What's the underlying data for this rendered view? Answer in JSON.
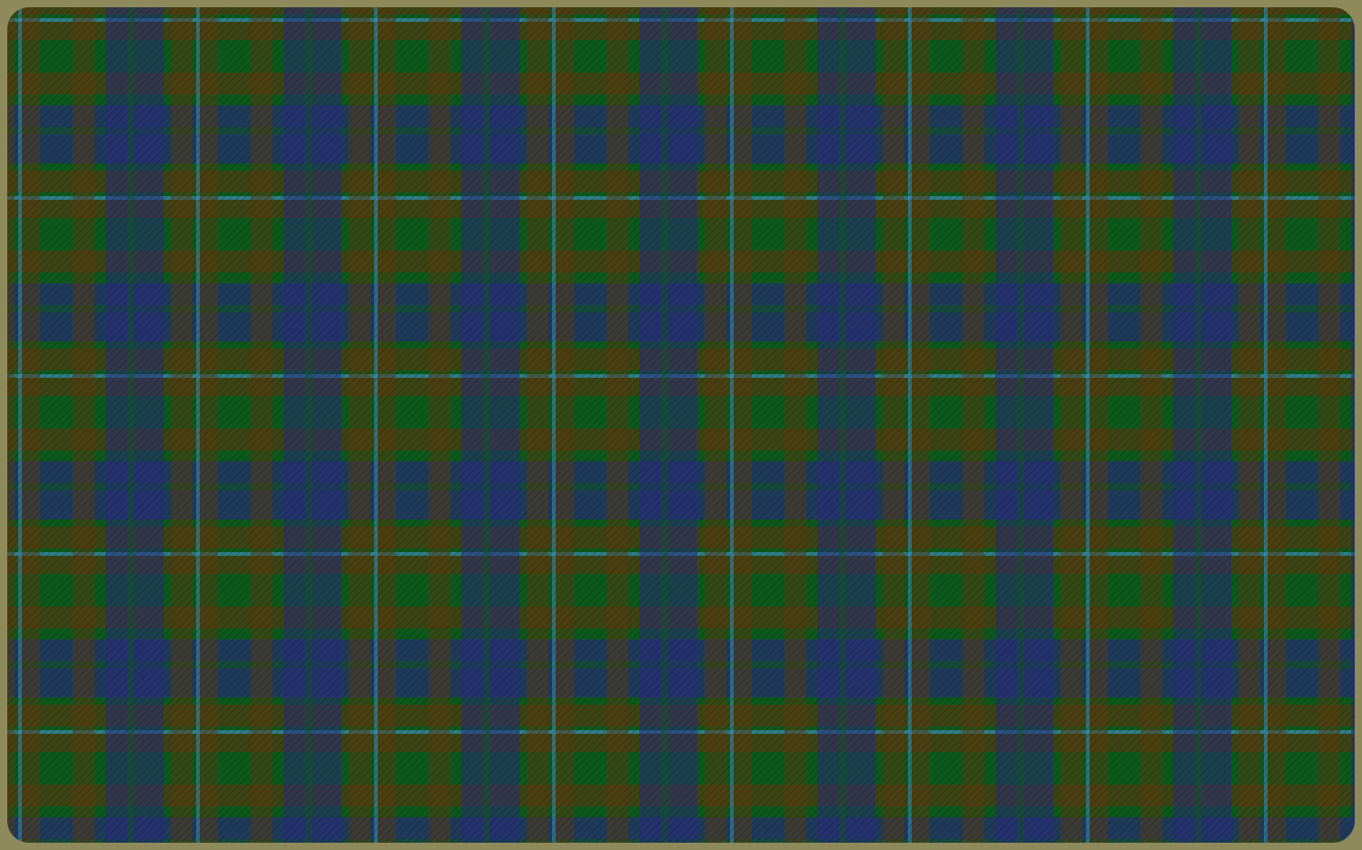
{
  "fabric": {
    "kind": "tartan"
  }
}
